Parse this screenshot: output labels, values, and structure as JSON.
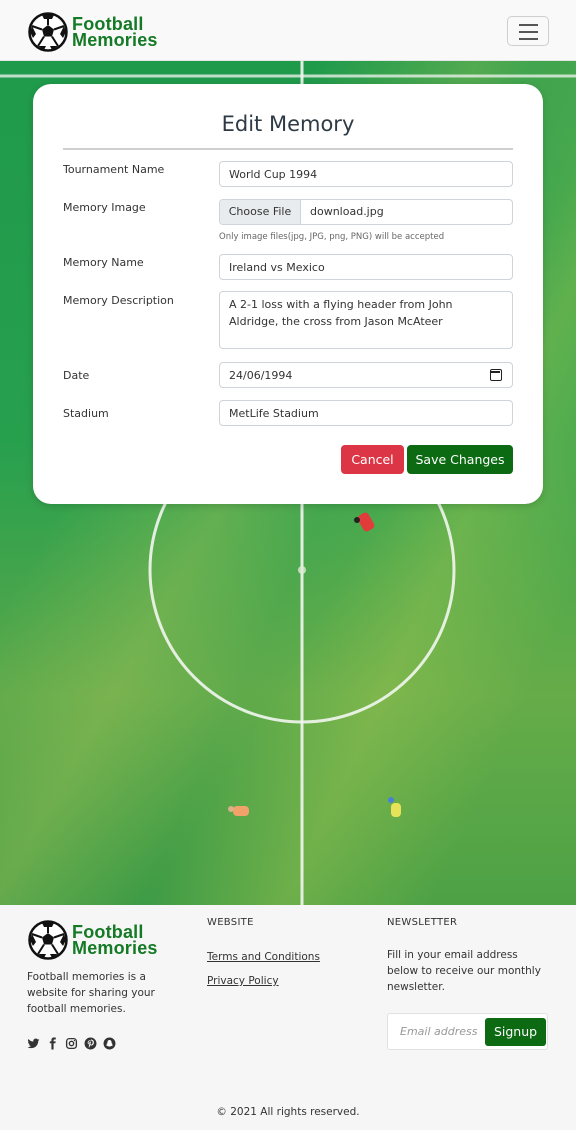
{
  "header": {
    "brand_line1": "Football",
    "brand_line2": "Memories"
  },
  "form": {
    "title": "Edit Memory",
    "tournament_label": "Tournament Name",
    "tournament_value": "World Cup 1994",
    "image_label": "Memory Image",
    "choose_file": "Choose File",
    "file_name": "download.jpg",
    "image_hint": "Only image files(jpg, JPG, png, PNG) will be accepted",
    "name_label": "Memory Name",
    "name_value": "Ireland vs Mexico",
    "description_label": "Memory Description",
    "description_value": "A 2-1 loss with a flying header from John Aldridge, the cross from Jason McAteer",
    "date_label": "Date",
    "date_value": "24/06/1994",
    "stadium_label": "Stadium",
    "stadium_value": "MetLife Stadium",
    "cancel": "Cancel",
    "save": "Save Changes"
  },
  "footer": {
    "brand_line1": "Football",
    "brand_line2": "Memories",
    "description": "Football memories is a website for sharing your football memories.",
    "socials": [
      "twitter-icon",
      "facebook-icon",
      "instagram-icon",
      "pinterest-icon",
      "snapchat-icon"
    ],
    "website_heading": "WEBSITE",
    "terms": "Terms and Conditions",
    "privacy": "Privacy Policy",
    "newsletter_heading": "NEWSLETTER",
    "newsletter_text": "Fill in your email address below to receive our monthly newsletter.",
    "email_placeholder": "Email address",
    "signup": "Signup",
    "copyright": "© 2021 All rights reserved."
  },
  "colors": {
    "brand_green": "#157a25",
    "save_green": "#0b6a12",
    "cancel_red": "#dc3545"
  }
}
